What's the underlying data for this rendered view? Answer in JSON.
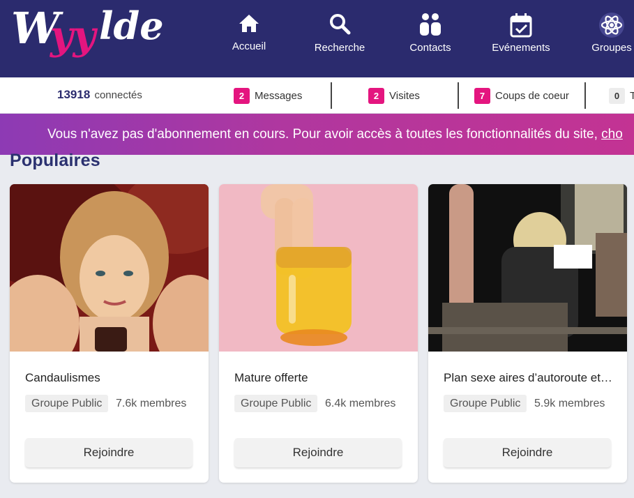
{
  "header": {
    "logo_text": "Wyylde",
    "nav": [
      {
        "label": "Accueil",
        "icon": "home-icon"
      },
      {
        "label": "Recherche",
        "icon": "search-icon"
      },
      {
        "label": "Contacts",
        "icon": "contacts-icon"
      },
      {
        "label": "Evénements",
        "icon": "calendar-icon"
      },
      {
        "label": "Groupes",
        "icon": "atom-icon"
      }
    ]
  },
  "stats": {
    "connected_count": "13918",
    "connected_label": "connectés",
    "messages": {
      "count": "2",
      "label": "Messages"
    },
    "visites": {
      "count": "2",
      "label": "Visites"
    },
    "coups": {
      "count": "7",
      "label": "Coups de coeur"
    },
    "fourth": {
      "count": "0",
      "label": "T"
    }
  },
  "promo": {
    "text": "Vous n'avez pas d'abonnement en cours. Pour avoir accès à toutes les fonctionnalités du site, ",
    "link": "cho"
  },
  "section": {
    "title": "Populaires"
  },
  "groups": [
    {
      "title": "Candaulismes",
      "tag": "Groupe Public",
      "members": "7.6k membres",
      "button": "Rejoindre"
    },
    {
      "title": "Mature offerte",
      "tag": "Groupe Public",
      "members": "6.4k membres",
      "button": "Rejoindre"
    },
    {
      "title": "Plan sexe aires d’autoroute et parking",
      "tag": "Groupe Public",
      "members": "5.9k membres",
      "button": "Rejoindre"
    }
  ],
  "colors": {
    "header_bg": "#2b2b6e",
    "accent_pink": "#e4157f",
    "banner_start": "#8d3ab4",
    "banner_end": "#c33393"
  }
}
